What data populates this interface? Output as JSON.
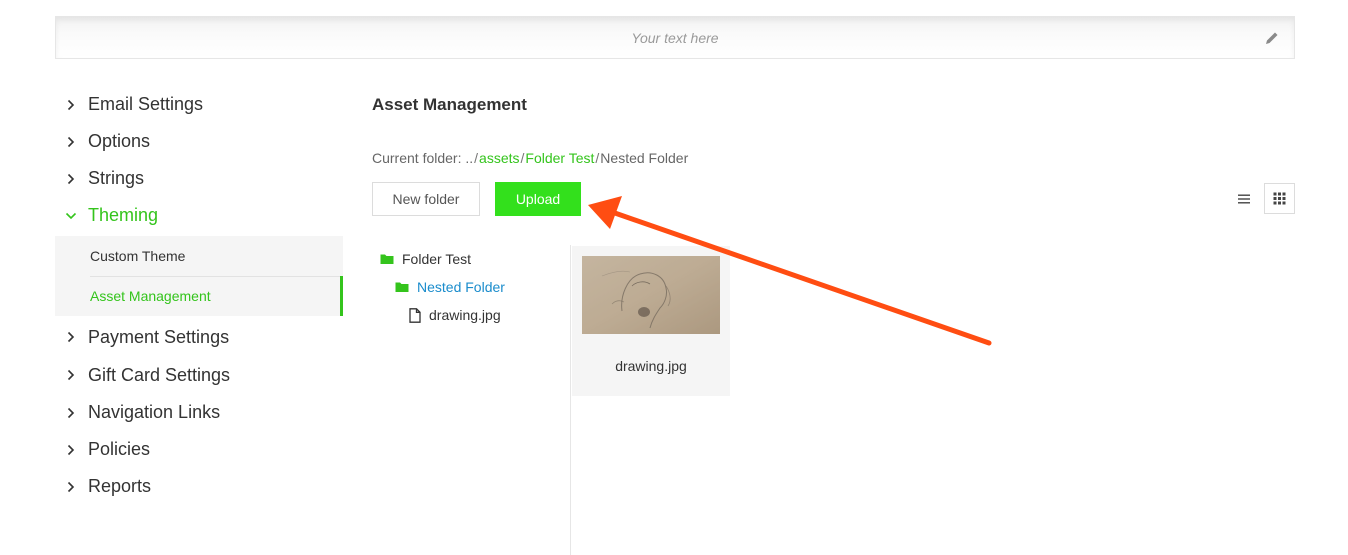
{
  "banner": {
    "placeholder": "Your text here",
    "edit_icon": "pencil-icon"
  },
  "sidebar": {
    "items": [
      {
        "label": "Email Settings"
      },
      {
        "label": "Options"
      },
      {
        "label": "Strings"
      },
      {
        "label": "Theming",
        "expanded": true
      },
      {
        "label": "Payment Settings"
      },
      {
        "label": "Gift Card Settings"
      },
      {
        "label": "Navigation Links"
      },
      {
        "label": "Policies"
      },
      {
        "label": "Reports"
      }
    ],
    "theming_sub": [
      {
        "label": "Custom Theme"
      },
      {
        "label": "Asset Management",
        "active": true
      }
    ]
  },
  "main": {
    "title": "Asset Management",
    "breadcrumb": {
      "prefix": "Current folder:",
      "root": "..",
      "sep": "/",
      "crumbs": [
        "assets",
        "Folder Test"
      ],
      "current": "Nested Folder"
    },
    "buttons": {
      "new_folder": "New folder",
      "upload": "Upload"
    },
    "view_icons": [
      "list-view-icon",
      "grid-view-icon"
    ],
    "tree": [
      {
        "label": "Folder Test",
        "type": "folder"
      },
      {
        "label": "Nested Folder",
        "type": "folder",
        "selected": true
      },
      {
        "label": "drawing.jpg",
        "type": "file"
      }
    ],
    "files": [
      {
        "name": "drawing.jpg"
      }
    ]
  },
  "colors": {
    "accent": "#34c41c",
    "upload_bg": "#33e01c",
    "link_blue": "#1a8ccc",
    "annotation_arrow": "#ff4d12"
  }
}
